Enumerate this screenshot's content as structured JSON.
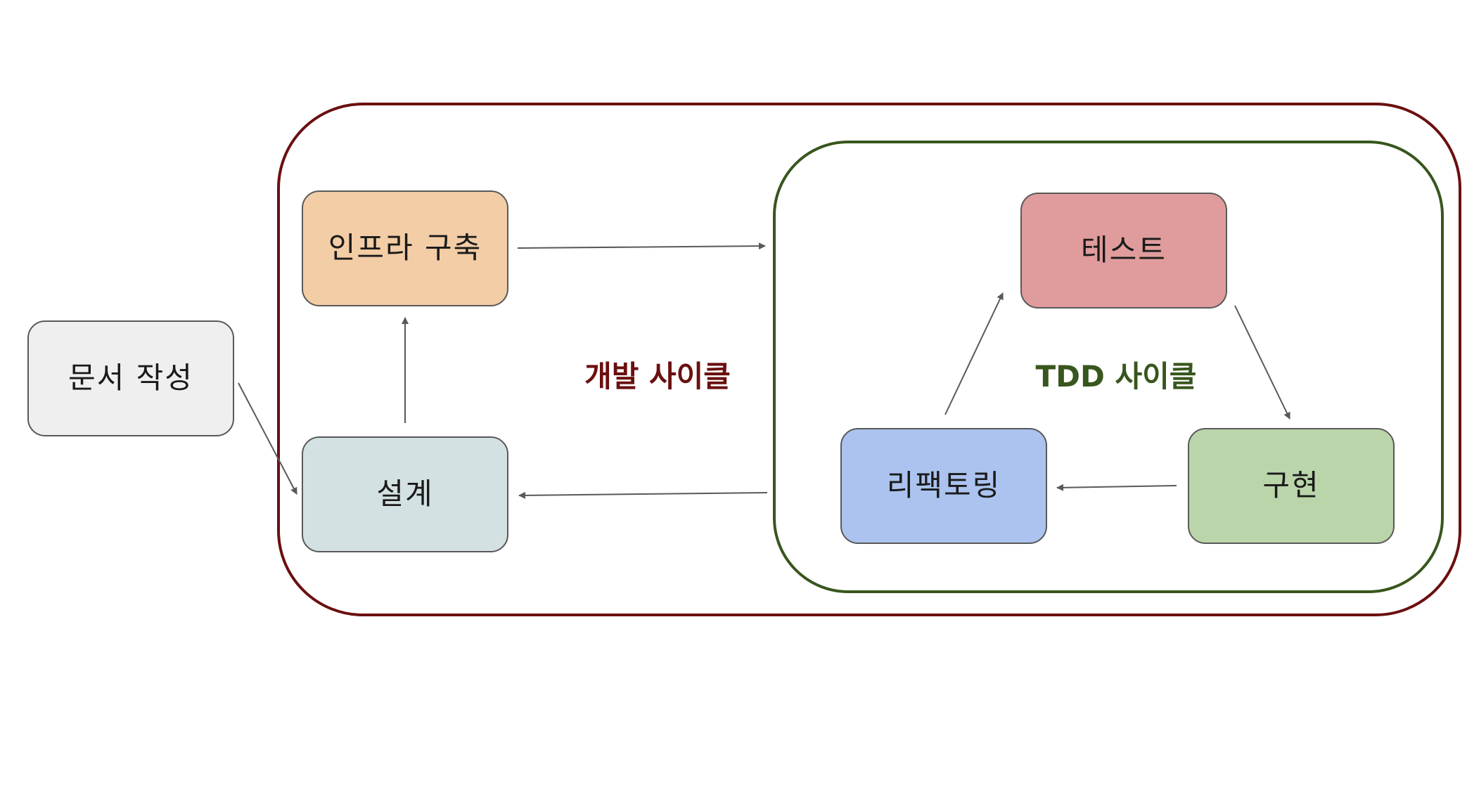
{
  "groups": {
    "dev_cycle": {
      "label": "개발 사이클",
      "color": "#6b0f0f"
    },
    "tdd_cycle": {
      "label": "TDD 사이클",
      "color": "#38561d"
    }
  },
  "nodes": {
    "document": {
      "label": "문서 작성",
      "fill": "#efefef"
    },
    "infra": {
      "label": "인프라 구축",
      "fill": "#f3cda6"
    },
    "design": {
      "label": "설계",
      "fill": "#d4e1e3"
    },
    "test": {
      "label": "테스트",
      "fill": "#e09c9c"
    },
    "implement": {
      "label": "구현",
      "fill": "#bbd5ab"
    },
    "refactor": {
      "label": "리팩토링",
      "fill": "#abc3ee"
    }
  },
  "edges": [
    {
      "from": "document",
      "to": "design"
    },
    {
      "from": "design",
      "to": "infra"
    },
    {
      "from": "infra",
      "to": "tdd_cycle"
    },
    {
      "from": "tdd_cycle",
      "to": "design"
    },
    {
      "from": "test",
      "to": "implement"
    },
    {
      "from": "implement",
      "to": "refactor"
    },
    {
      "from": "refactor",
      "to": "test"
    }
  ]
}
